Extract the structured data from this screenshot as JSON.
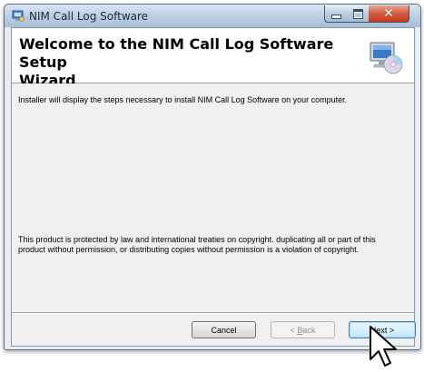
{
  "window": {
    "title": "NIM Call Log Software",
    "title_icon": "installer-icon",
    "controls": {
      "minimize_icon": "minimize-icon",
      "maximize_icon": "maximize-icon",
      "close_icon": "close-icon"
    }
  },
  "banner": {
    "heading_line1": "Welcome to the NIM Call Log Software Setup",
    "heading_line2": "Wizard",
    "icon": "computer-cd-icon"
  },
  "body": {
    "intro": "Installer will display the steps necessary to install NIM Call Log Software on your computer.",
    "legal_line1": "This product is protected by law and international treaties on copyright. duplicating all or part of this",
    "legal_line2": "product without permission, or distributing copies without permission is a violation of copyright."
  },
  "buttons": {
    "cancel": "Cancel",
    "back_prefix": "< ",
    "back_mnemonic": "B",
    "back_rest": "ack",
    "next_mnemonic": "N",
    "next_rest": "ext >"
  },
  "colors": {
    "accent": "#3c7fb1",
    "titlebar": "#b9cde2",
    "close": "#c43a1f"
  }
}
